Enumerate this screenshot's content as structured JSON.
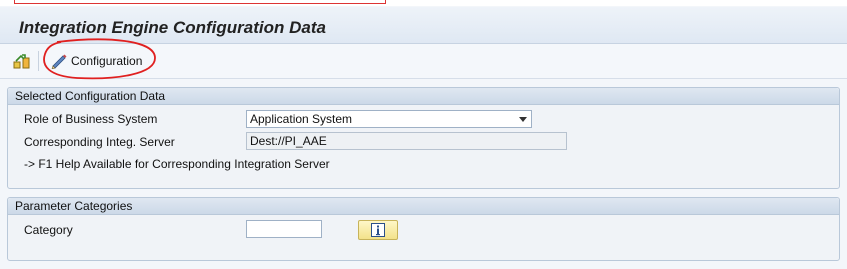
{
  "header": {
    "title": "Integration Engine Configuration Data"
  },
  "toolbar": {
    "configuration_label": "Configuration"
  },
  "selected_config": {
    "heading": "Selected Configuration Data",
    "role_label": "Role of Business System",
    "role_value": "Application System",
    "server_label": "Corresponding Integ. Server",
    "server_value": "Dest://PI_AAE",
    "help_text": "-> F1 Help Available for Corresponding Integration Server"
  },
  "parameter_categories": {
    "heading": "Parameter Categories",
    "category_label": "Category",
    "category_value": ""
  },
  "colors": {
    "title_bar": "#dfe8f3",
    "group_header": "#ccd9e8",
    "info_button": "#f3e28a",
    "annotation": "#e02020"
  }
}
